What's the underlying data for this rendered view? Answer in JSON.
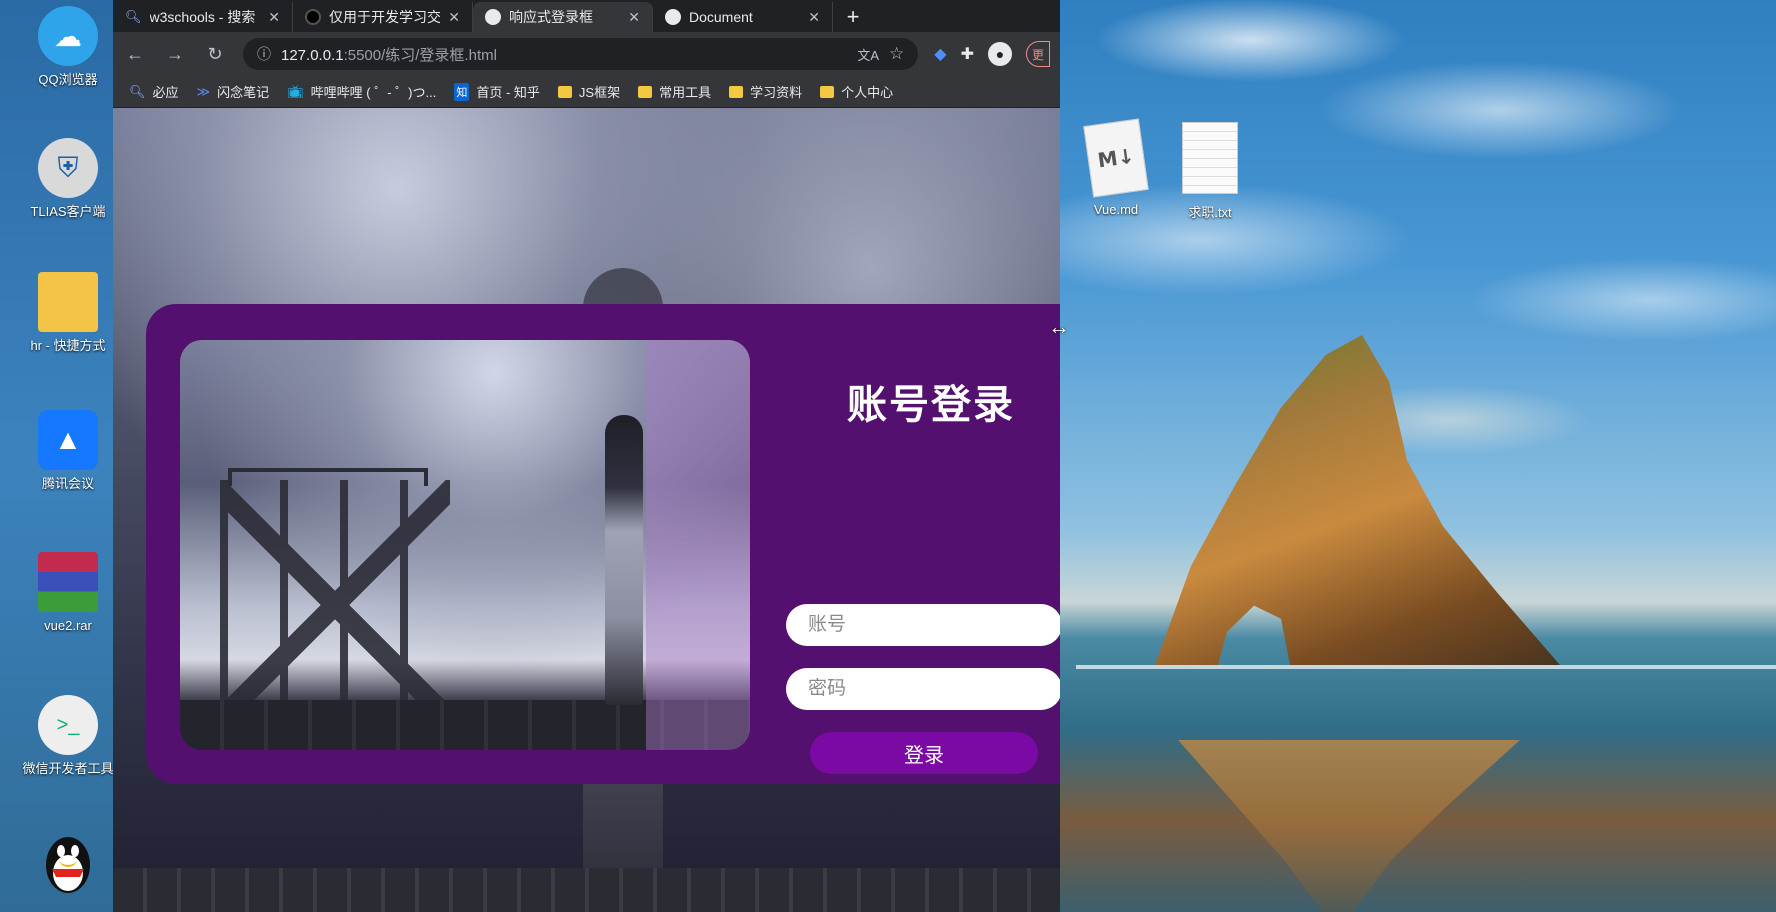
{
  "browser": {
    "tabs": [
      {
        "title": "w3schools - 搜索",
        "favicon": "search-icon"
      },
      {
        "title": "仅用于开发学习交",
        "favicon": "github-icon"
      },
      {
        "title": "响应式登录框",
        "favicon": "globe-icon",
        "active": true
      },
      {
        "title": "Document",
        "favicon": "globe-icon"
      }
    ],
    "new_tab": "+",
    "url_host": "127.0.0.1",
    "url_rest": ":5500/练习/登录框.html",
    "update_label": "更"
  },
  "bookmarks": [
    {
      "label": "必应",
      "icon": "search-icon"
    },
    {
      "label": "闪念笔记",
      "icon": "note-icon"
    },
    {
      "label": "哔哩哔哩 ( ゜- ゜)つ...",
      "icon": "bilibili-icon"
    },
    {
      "label": "首页 - 知乎",
      "icon": "zhihu-icon"
    },
    {
      "label": "JS框架",
      "icon": "folder-icon"
    },
    {
      "label": "常用工具",
      "icon": "folder-icon"
    },
    {
      "label": "学习资料",
      "icon": "folder-icon"
    },
    {
      "label": "个人中心",
      "icon": "folder-icon"
    }
  ],
  "login": {
    "title": "账号登录",
    "account_placeholder": "账号",
    "password_placeholder": "密码",
    "submit_label": "登录"
  },
  "desktop_left": [
    {
      "label": "QQ浏览器"
    },
    {
      "label": "TLIAS客户端"
    },
    {
      "label": "hr - 快捷方式"
    },
    {
      "label": "腾讯会议"
    },
    {
      "label": "vue2.rar"
    },
    {
      "label": "微信开发者工具"
    }
  ],
  "desktop_right": [
    {
      "label": "Vue.md"
    },
    {
      "label": "求职.txt"
    }
  ],
  "colors": {
    "card": "#54106f",
    "button": "#7a0aa3"
  }
}
